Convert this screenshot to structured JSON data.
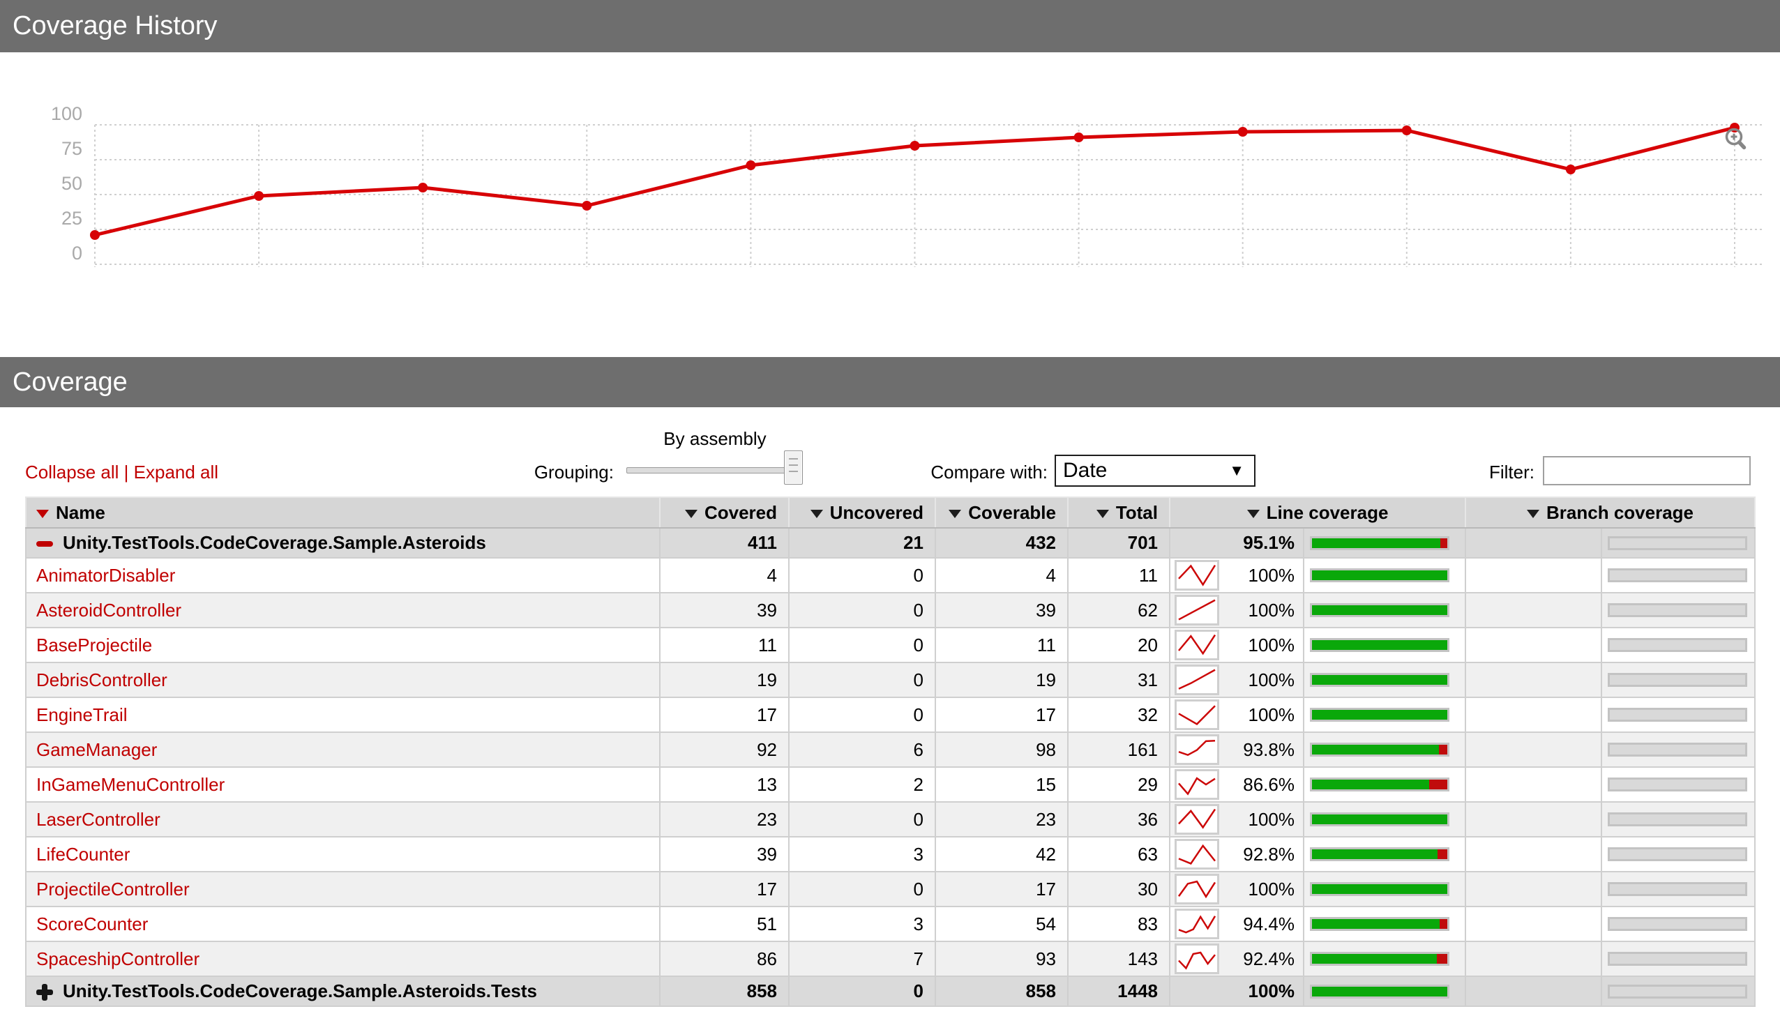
{
  "history": {
    "title": "Coverage History"
  },
  "chart_data": {
    "type": "line",
    "title": "Coverage History",
    "x": [
      1,
      2,
      3,
      4,
      5,
      6,
      7,
      8,
      9,
      10,
      11
    ],
    "values": [
      21,
      49,
      55,
      42,
      71,
      85,
      91,
      95,
      96,
      68,
      98
    ],
    "xlabel": "",
    "ylabel": "",
    "ylim": [
      0,
      100
    ],
    "yticks": [
      0,
      25,
      50,
      75,
      100
    ],
    "grid": "dashed",
    "legend": "none",
    "line_color": "#d70206"
  },
  "coverage": {
    "title": "Coverage",
    "controls": {
      "collapse_all": "Collapse all",
      "separator": "|",
      "expand_all": "Expand all",
      "grouping_label": "Grouping:",
      "grouping_value_label": "By assembly",
      "compare_label": "Compare with:",
      "compare_value": "Date",
      "filter_label": "Filter:",
      "filter_value": ""
    },
    "table": {
      "headers": [
        {
          "label": "Name",
          "sorted": true
        },
        {
          "label": "Covered"
        },
        {
          "label": "Uncovered"
        },
        {
          "label": "Coverable"
        },
        {
          "label": "Total"
        },
        {
          "label": "Line coverage"
        },
        {
          "label": "Branch coverage"
        }
      ],
      "rows": [
        {
          "type": "assembly",
          "icon": "minus",
          "name": "Unity.TestTools.CodeCoverage.Sample.Asteroids",
          "covered": "411",
          "uncovered": "21",
          "coverable": "432",
          "total": "701",
          "line_pct": "95.1%",
          "line_rate": 95.1
        },
        {
          "type": "class",
          "name": "AnimatorDisabler",
          "covered": "4",
          "uncovered": "0",
          "coverable": "4",
          "total": "11",
          "line_pct": "100%",
          "line_rate": 100,
          "trend": [
            35,
            92,
            8,
            95
          ]
        },
        {
          "type": "class",
          "name": "AsteroidController",
          "covered": "39",
          "uncovered": "0",
          "coverable": "39",
          "total": "62",
          "line_pct": "100%",
          "line_rate": 100,
          "trend": [
            8,
            95
          ]
        },
        {
          "type": "class",
          "name": "BaseProjectile",
          "covered": "11",
          "uncovered": "0",
          "coverable": "11",
          "total": "20",
          "line_pct": "100%",
          "line_rate": 100,
          "trend": [
            25,
            90,
            12,
            95
          ]
        },
        {
          "type": "class",
          "name": "DebrisController",
          "covered": "19",
          "uncovered": "0",
          "coverable": "19",
          "total": "31",
          "line_pct": "100%",
          "line_rate": 100,
          "trend": [
            10,
            35,
            65,
            95
          ]
        },
        {
          "type": "class",
          "name": "EngineTrail",
          "covered": "17",
          "uncovered": "0",
          "coverable": "17",
          "total": "32",
          "line_pct": "100%",
          "line_rate": 100,
          "trend": [
            55,
            8,
            90
          ]
        },
        {
          "type": "class",
          "name": "GameManager",
          "covered": "92",
          "uncovered": "6",
          "coverable": "98",
          "total": "161",
          "line_pct": "93.8%",
          "line_rate": 93.8,
          "trend": [
            40,
            26,
            48,
            88,
            90
          ]
        },
        {
          "type": "class",
          "name": "InGameMenuController",
          "covered": "13",
          "uncovered": "2",
          "coverable": "15",
          "total": "29",
          "line_pct": "86.6%",
          "line_rate": 86.6,
          "trend": [
            55,
            8,
            78,
            50,
            76
          ]
        },
        {
          "type": "class",
          "name": "LaserController",
          "covered": "23",
          "uncovered": "0",
          "coverable": "23",
          "total": "36",
          "line_pct": "100%",
          "line_rate": 100,
          "trend": [
            30,
            88,
            14,
            95
          ]
        },
        {
          "type": "class",
          "name": "LifeCounter",
          "covered": "39",
          "uncovered": "3",
          "coverable": "42",
          "total": "63",
          "line_pct": "92.8%",
          "line_rate": 92.8,
          "trend": [
            30,
            8,
            88,
            20
          ]
        },
        {
          "type": "class",
          "name": "ProjectileController",
          "covered": "17",
          "uncovered": "0",
          "coverable": "17",
          "total": "30",
          "line_pct": "100%",
          "line_rate": 100,
          "trend": [
            18,
            74,
            84,
            16,
            80
          ]
        },
        {
          "type": "class",
          "name": "ScoreCounter",
          "covered": "51",
          "uncovered": "3",
          "coverable": "54",
          "total": "83",
          "line_pct": "94.4%",
          "line_rate": 94.4,
          "trend": [
            24,
            12,
            26,
            82,
            30,
            85
          ]
        },
        {
          "type": "class",
          "name": "SpaceshipController",
          "covered": "86",
          "uncovered": "7",
          "coverable": "93",
          "total": "143",
          "line_pct": "92.4%",
          "line_rate": 92.4,
          "trend": [
            42,
            8,
            72,
            78,
            28,
            68
          ]
        },
        {
          "type": "assembly",
          "icon": "plus",
          "name": "Unity.TestTools.CodeCoverage.Sample.Asteroids.Tests",
          "covered": "858",
          "uncovered": "0",
          "coverable": "858",
          "total": "1448",
          "line_pct": "100%",
          "line_rate": 100
        }
      ]
    }
  },
  "colors": {
    "covered_green": "#0aa80a",
    "uncovered_red": "#c00c0c",
    "empty_bar_gray": "#d9d9d9",
    "chart_line_red": "#d70206",
    "sparkline_red": "#cc0707",
    "link_red": "#c00000",
    "header_gray": "#6e6e6e",
    "grid_gray": "#cfcfcf",
    "axis_label_gray": "#a9a9a9",
    "magnifier_gray": "#878787"
  }
}
